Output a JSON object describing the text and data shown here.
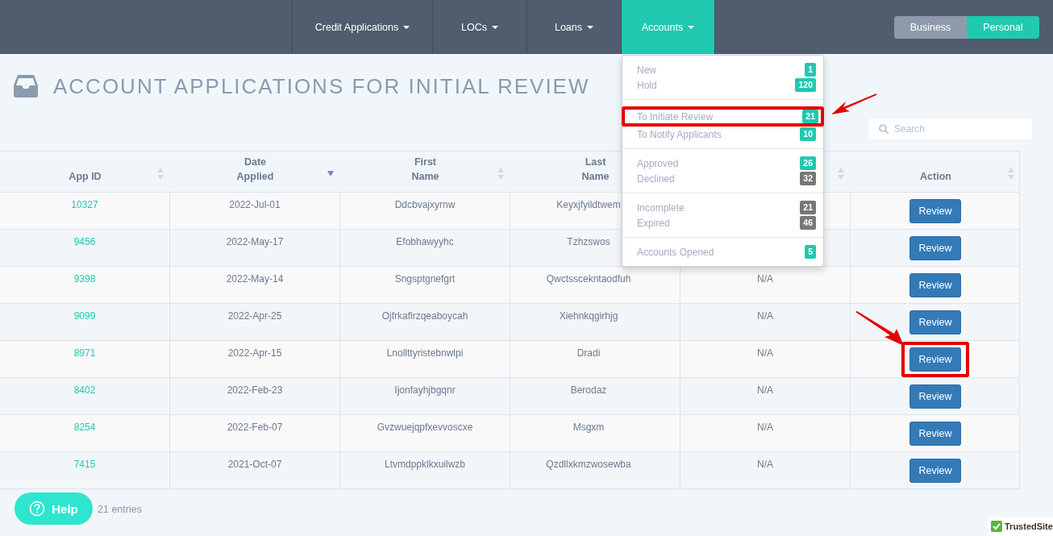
{
  "nav": {
    "items": [
      {
        "label": "Credit Applications",
        "selected": false
      },
      {
        "label": "LOCs",
        "selected": false
      },
      {
        "label": "Loans",
        "selected": false
      },
      {
        "label": "Accounts",
        "selected": true
      }
    ],
    "toggle": [
      {
        "label": "Business",
        "selected": false
      },
      {
        "label": "Personal",
        "selected": true
      }
    ]
  },
  "page": {
    "title": "ACCOUNT APPLICATIONS FOR INITIAL REVIEW"
  },
  "search": {
    "placeholder": "Search"
  },
  "dropdown": {
    "groups": [
      [
        {
          "label": "New",
          "count": "1",
          "color": "#20c9b0",
          "highlighted": false
        },
        {
          "label": "Hold",
          "count": "120",
          "color": "#20c9b0",
          "highlighted": false
        }
      ],
      [
        {
          "label": "To Initiate Review",
          "count": "21",
          "color": "#20c9b0",
          "highlighted": true
        },
        {
          "label": "To Notify Applicants",
          "count": "10",
          "color": "#20c9b0",
          "highlighted": false
        }
      ],
      [
        {
          "label": "Approved",
          "count": "26",
          "color": "#20c9b0",
          "highlighted": false
        },
        {
          "label": "Declined",
          "count": "32",
          "color": "#777777",
          "highlighted": false
        }
      ],
      [
        {
          "label": "Incomplete",
          "count": "21",
          "color": "#777777",
          "highlighted": false
        },
        {
          "label": "Expired",
          "count": "46",
          "color": "#777777",
          "highlighted": false
        }
      ],
      [
        {
          "label": "Accounts Opened",
          "count": "5",
          "color": "#20c9b0",
          "highlighted": false
        }
      ]
    ]
  },
  "table": {
    "columns": [
      {
        "label": [
          "App ID"
        ],
        "sorted": false
      },
      {
        "label": [
          "Date",
          "Applied"
        ],
        "sorted": true
      },
      {
        "label": [
          "First",
          "Name"
        ],
        "sorted": false
      },
      {
        "label": [
          "Last",
          "Name"
        ]
      },
      {
        "sorted": false
      },
      {
        "label": [
          "Action"
        ],
        "sorted": false
      }
    ],
    "rows": [
      {
        "app_id": "10327",
        "date": "2022-Jul-01",
        "first": "Ddcbvajxyrnw",
        "last": "Keyxjfyildtwem",
        "action": "Review",
        "highlighted": false
      },
      {
        "app_id": "9456",
        "date": "2022-May-17",
        "first": "Efobhawyyhc",
        "last": "Tzhzswos",
        "action": "Review",
        "highlighted": false
      },
      {
        "app_id": "9398",
        "date": "2022-May-14",
        "first": "Sngsptgnefgrt",
        "last": "Qwctsscekntaodfuh",
        "column_5": "N/A",
        "action": "Review",
        "highlighted": false
      },
      {
        "app_id": "9099",
        "date": "2022-Apr-25",
        "first": "Ojfrkaflrzqeaboycah",
        "last": "Xiehnkqgirhjg",
        "column_5": "N/A",
        "action": "Review",
        "highlighted": false
      },
      {
        "app_id": "8971",
        "date": "2022-Apr-15",
        "first": "Lnollttyristebnwlpi",
        "last": "Dradi",
        "column_5": "N/A",
        "action": "Review",
        "highlighted": true
      },
      {
        "app_id": "8402",
        "date": "2022-Feb-23",
        "first": "Ijonfayhjbgqnr",
        "last": "Berodaz",
        "column_5": "N/A",
        "action": "Review",
        "highlighted": false
      },
      {
        "app_id": "8254",
        "date": "2022-Feb-07",
        "first": "Gvzwuejqpfxevvoscxe",
        "last": "Msgxm",
        "column_5": "N/A",
        "action": "Review",
        "highlighted": false
      },
      {
        "app_id": "7415",
        "date": "2021-Oct-07",
        "first": "Ltvmdppklkxuilwzb",
        "last": "Qzdllxkmzwosewba",
        "column_5": "N/A",
        "action": "Review",
        "highlighted": false
      }
    ]
  },
  "footer": {
    "entries": "21 entries"
  },
  "help": {
    "label": "Help"
  },
  "badge": {
    "label": "TrustedSite"
  }
}
